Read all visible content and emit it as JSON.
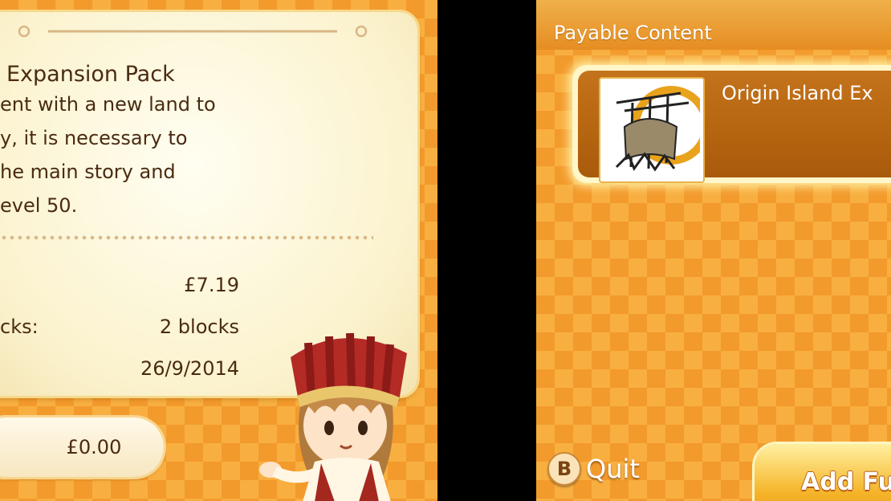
{
  "left_screen": {
    "pack_title": "Expansion Pack",
    "description_lines": [
      "ent with a new land to",
      "y, it is necessary to",
      "he main story and",
      "evel 50."
    ],
    "details": [
      {
        "label": "",
        "value": "£7.19"
      },
      {
        "label": "cks:",
        "value": "2 blocks"
      },
      {
        "label": "",
        "value": "26/9/2014"
      }
    ],
    "price_button_label": "£0.00"
  },
  "right_screen": {
    "header_title": "Payable Content",
    "item": {
      "name": "Origin Island Ex",
      "thumbnail": "origin-island-artwork"
    },
    "quit": {
      "button_glyph": "B",
      "label": "Quit"
    },
    "add_button_label": "Add Fu"
  },
  "colors": {
    "background_orange": "#f39a2c",
    "card_cream": "#fbf2cd",
    "text_brown": "#4a2b12",
    "item_brown": "#b5640f"
  }
}
